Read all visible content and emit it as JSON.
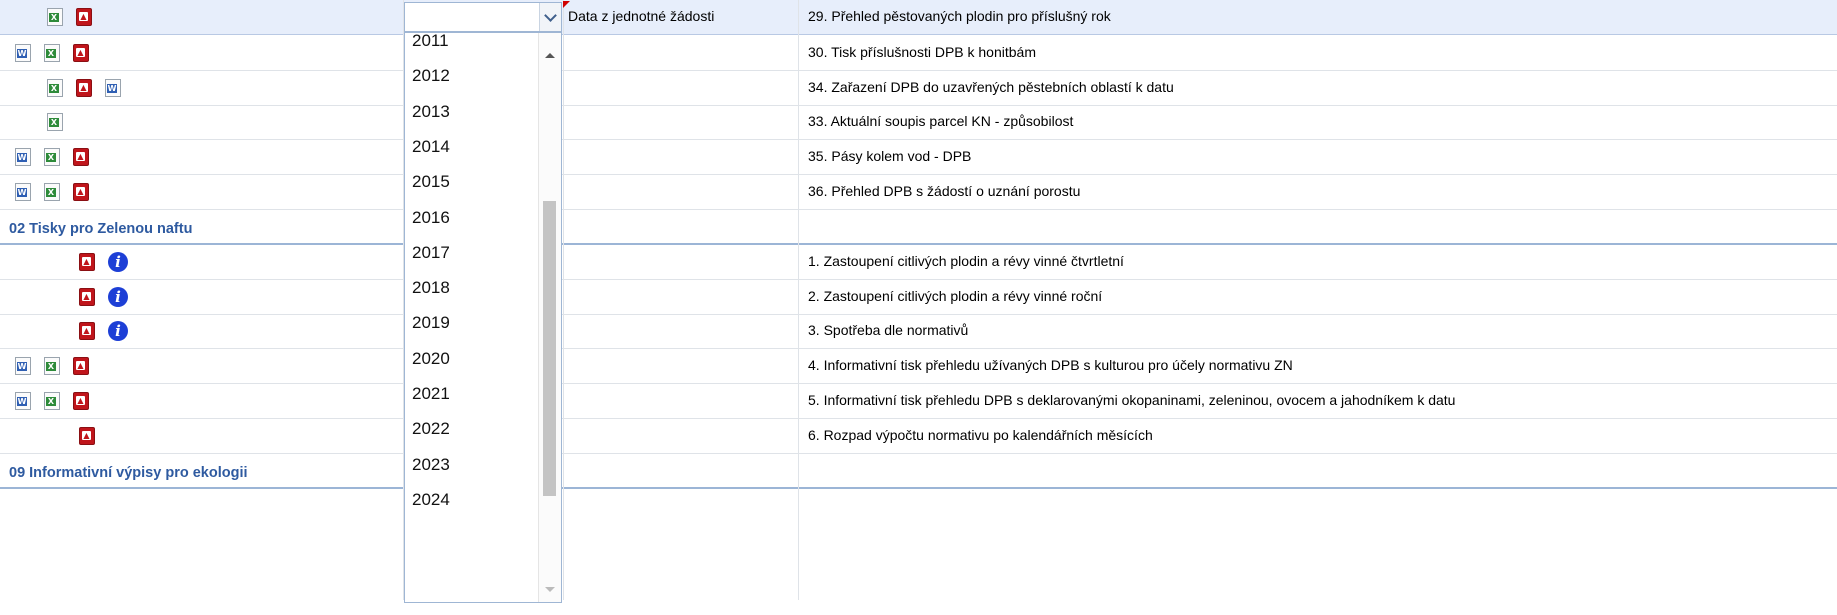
{
  "combo": {
    "selected": "",
    "source_label": "Data z jednotné žádosti",
    "years": [
      "2011",
      "2012",
      "2013",
      "2014",
      "2015",
      "2016",
      "2017",
      "2018",
      "2019",
      "2020",
      "2021",
      "2022",
      "2023",
      "2024"
    ]
  },
  "rows": [
    {
      "icons": [
        "excel",
        "pdf"
      ],
      "description": "29. Přehled pěstovaných plodin pro příslušný rok"
    },
    {
      "icons": [
        "word",
        "excel",
        "pdf"
      ],
      "description": "30. Tisk příslušnosti DPB k honitbám"
    },
    {
      "icons": [
        "excel",
        "pdf",
        "word"
      ],
      "description": "34. Zařazení DPB do uzavřených pěstebních oblastí k datu"
    },
    {
      "icons": [
        "excel"
      ],
      "description": "33. Aktuální soupis parcel KN - způsobilost"
    },
    {
      "icons": [
        "word",
        "excel",
        "pdf"
      ],
      "description": "35. Pásy kolem vod - DPB"
    },
    {
      "icons": [
        "word",
        "excel",
        "pdf"
      ],
      "description": "36. Přehled DPB s žádostí o uznání porostu"
    },
    {
      "group": "02 Tisky pro Zelenou naftu"
    },
    {
      "icons": [
        "pdf",
        "info"
      ],
      "description": "1. Zastoupení citlivých plodin a révy vinné čtvrtletní"
    },
    {
      "icons": [
        "pdf",
        "info"
      ],
      "description": "2. Zastoupení citlivých plodin a révy vinné roční"
    },
    {
      "icons": [
        "pdf",
        "info"
      ],
      "description": "3. Spotřeba dle normativů"
    },
    {
      "icons": [
        "word",
        "excel",
        "pdf"
      ],
      "description": "4. Informativní tisk přehledu užívaných DPB s kulturou pro účely normativu ZN"
    },
    {
      "icons": [
        "word",
        "excel",
        "pdf"
      ],
      "description": "5. Informativní tisk přehledu DPB s deklarovanými okopaninami, zeleninou, ovocem a jahodníkem k datu"
    },
    {
      "icons": [
        "pdf"
      ],
      "description": "6. Rozpad výpočtu normativu po kalendářních měsících"
    },
    {
      "group": "09 Informativní výpisy pro ekologii"
    }
  ],
  "colors": {
    "group_title": "#2e5aa0",
    "selected_row": "#e7eefb",
    "pdf": "#c0151b",
    "excel": "#2e8b3a",
    "word": "#2f5fb3",
    "info": "#1d3fd6"
  }
}
